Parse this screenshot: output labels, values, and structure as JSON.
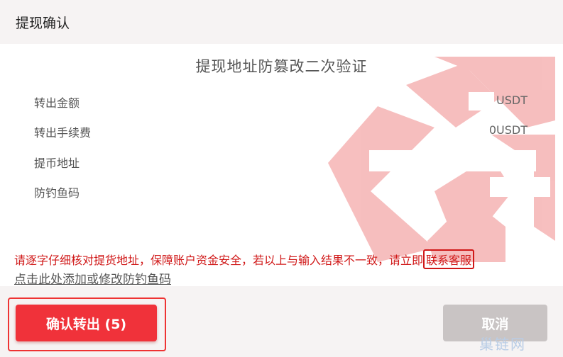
{
  "dialog": {
    "title": "提现确认"
  },
  "heading": "提现地址防篡改二次验证",
  "rows": [
    {
      "label": "转出金额",
      "value": "USDT"
    },
    {
      "label": "转出手续费",
      "value": "0USDT"
    },
    {
      "label": "提币地址",
      "value": ""
    },
    {
      "label": "防钓鱼码",
      "value": ""
    }
  ],
  "warning": {
    "text": "请逐字仔细核对提货地址，保障账户资金安全，若以上与输入结果不一致，请立即",
    "contact_link": "联系客服"
  },
  "fishcode_link": "点击此处添加或修改防钓鱼码",
  "buttons": {
    "confirm": "确认转出 (5)",
    "cancel": "取消"
  },
  "watermark_brand": "巢链网",
  "colors": {
    "accent_red": "#f0323a",
    "warning_red": "#d01818",
    "cancel_grey": "#c9c4c4",
    "watermark_red": "#f08a8a"
  }
}
